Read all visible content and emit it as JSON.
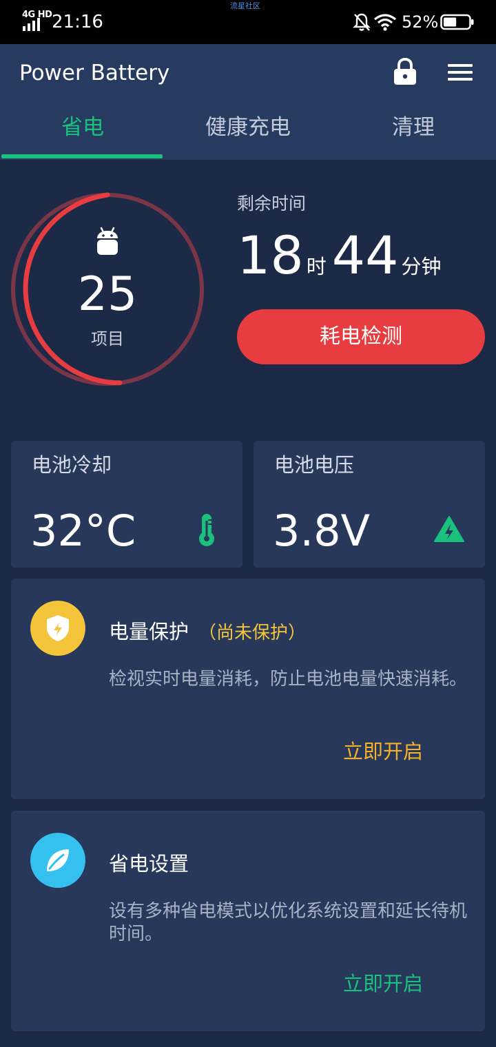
{
  "status_bar": {
    "network": "4G HD",
    "time": "21:16",
    "watermark": "流星社区",
    "battery_percent": "52%",
    "battery_level": 0.52,
    "icons": [
      "signal-icon",
      "mute-bell-icon",
      "wifi-icon",
      "battery-icon"
    ]
  },
  "header": {
    "title": "Power Battery",
    "icons": [
      "lock-icon",
      "menu-icon"
    ]
  },
  "tabs": [
    {
      "label": "省电",
      "active": true
    },
    {
      "label": "健康充电",
      "active": false
    },
    {
      "label": "清理",
      "active": false
    }
  ],
  "summary": {
    "item_count": "25",
    "item_unit": "项目",
    "remaining_label": "剩余时间",
    "hours": "18",
    "hours_unit": "时",
    "minutes": "44",
    "minutes_unit": "分钟",
    "detect_button": "耗电检测"
  },
  "stats": {
    "cooling": {
      "label": "电池冷却",
      "value": "32°C",
      "icon": "thermometer-icon"
    },
    "voltage": {
      "label": "电池电压",
      "value": "3.8V",
      "icon": "voltage-warning-icon"
    }
  },
  "features": [
    {
      "title": "电量保护",
      "status": "（尚未保护）",
      "description": "检视实时电量消耗，防止电池电量快速消耗。",
      "action": "立即开启",
      "icon": "shield-icon",
      "icon_color": "#f4c43a",
      "action_color": "#f4b12a"
    },
    {
      "title": "省电设置",
      "status": "",
      "description": "设有多种省电模式以优化系统设置和延长待机时间。",
      "action": "立即开启",
      "icon": "leaf-icon",
      "icon_color": "#35c1f0",
      "action_color": "#19c17d"
    }
  ],
  "colors": {
    "accent_green": "#19c17d",
    "danger_red": "#e83d40",
    "background": "#1d2a47",
    "card": "#27385b"
  }
}
